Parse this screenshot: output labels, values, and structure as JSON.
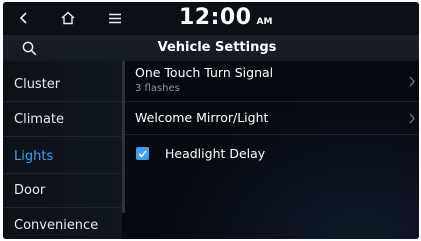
{
  "status_bar": {
    "time": "12:00",
    "ampm": "AM"
  },
  "header": {
    "title": "Vehicle Settings"
  },
  "sidebar": {
    "items": [
      {
        "label": "Cluster"
      },
      {
        "label": "Climate"
      },
      {
        "label": "Lights",
        "selected": true
      },
      {
        "label": "Door"
      },
      {
        "label": "Convenience"
      }
    ]
  },
  "settings": {
    "one_touch_turn_signal": {
      "label": "One Touch Turn Signal",
      "value": "3 flashes"
    },
    "welcome_mirror_light": {
      "label": "Welcome Mirror/Light"
    },
    "headlight_delay": {
      "label": "Headlight Delay",
      "checked": true
    }
  },
  "colors": {
    "accent": "#3d9ff0",
    "background": "#05080d",
    "text": "#ffffff",
    "subtext": "#8d949d"
  },
  "icons": [
    "back-icon",
    "home-icon",
    "menu-icon",
    "search-icon",
    "chevron-right-icon",
    "checkmark-icon"
  ]
}
